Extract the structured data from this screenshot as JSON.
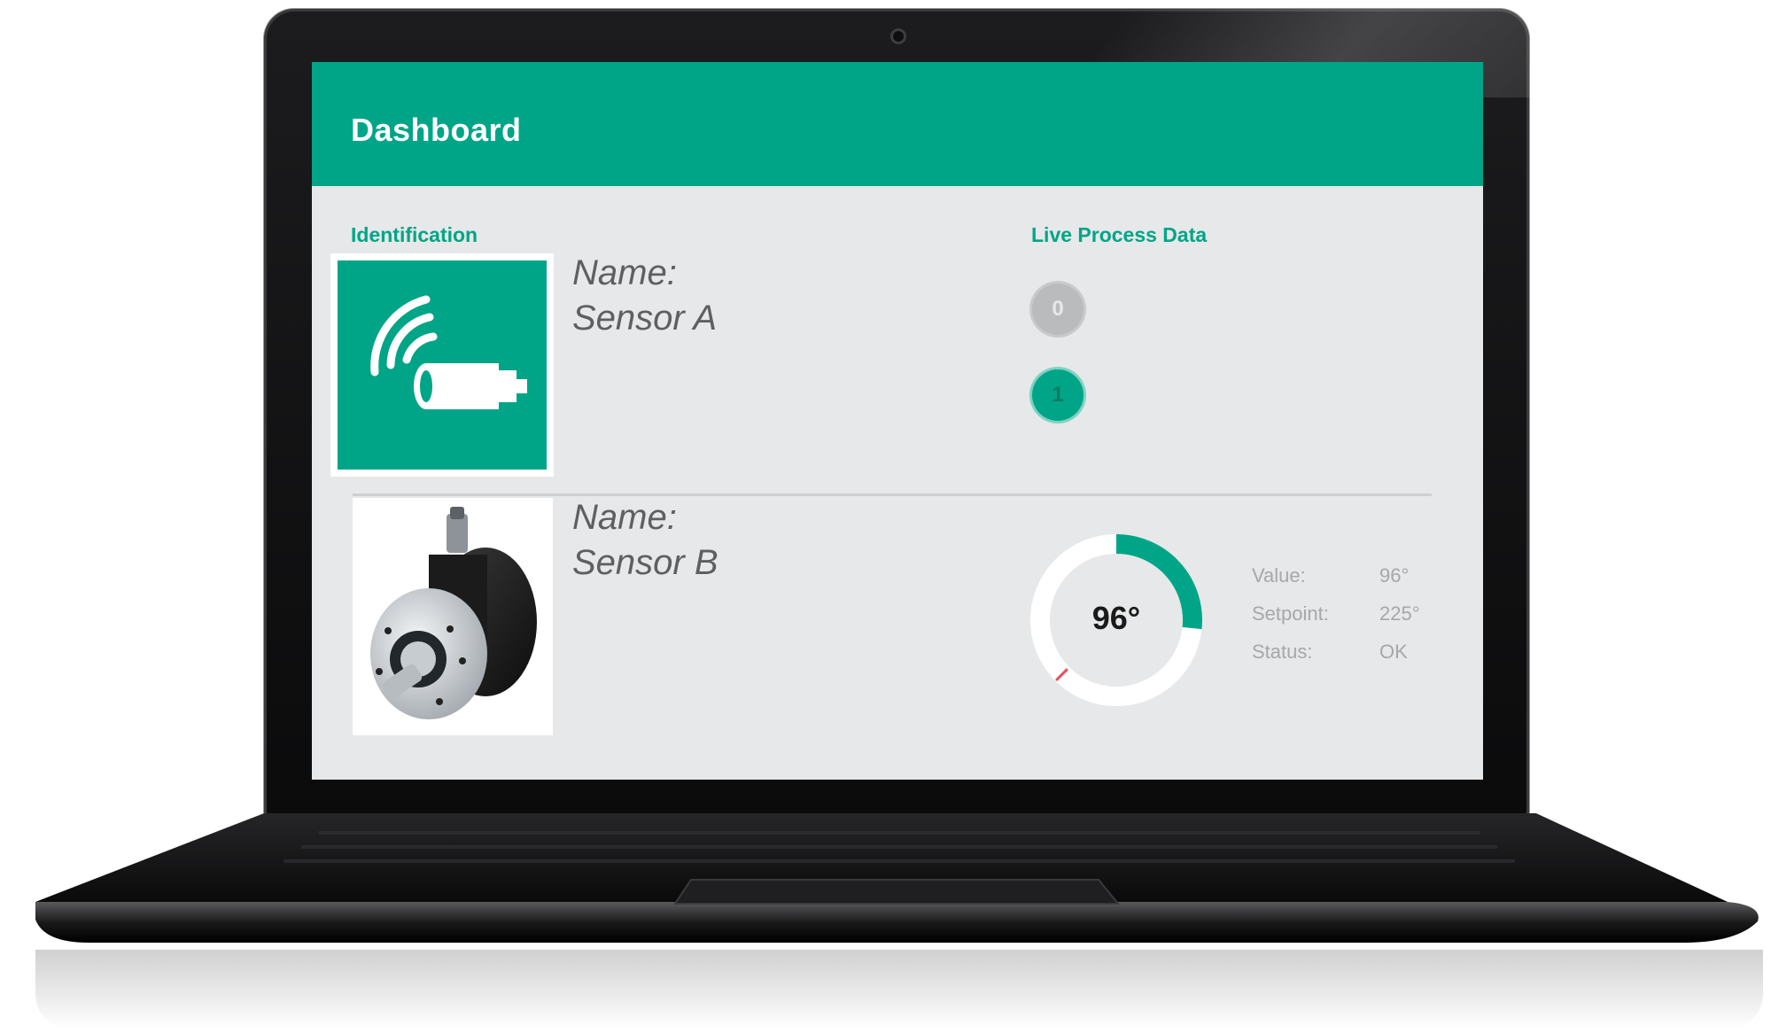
{
  "header": {
    "title": "Dashboard"
  },
  "identification": {
    "title": "Identification",
    "sensors": [
      {
        "name_label": "Name:",
        "name_value": "Sensor A"
      },
      {
        "name_label": "Name:",
        "name_value": "Sensor B"
      }
    ]
  },
  "live": {
    "title": "Live Process Data",
    "bits": [
      {
        "label": "0",
        "state": "off"
      },
      {
        "label": "1",
        "state": "on"
      }
    ],
    "gauge": {
      "display": "96°",
      "value": 96,
      "max": 360,
      "setpoint": 225,
      "rows": [
        {
          "key": "Value:",
          "val": "96°"
        },
        {
          "key": "Setpoint:",
          "val": "225°"
        },
        {
          "key": "Status:",
          "val": "OK"
        }
      ]
    }
  },
  "colors": {
    "accent": "#00a587",
    "panel": "#e7e8e9",
    "setpoint_marker": "#e8505b"
  },
  "icons": {
    "sensor_a": "wireless-sensor-icon",
    "sensor_b": "rotary-encoder-icon"
  }
}
